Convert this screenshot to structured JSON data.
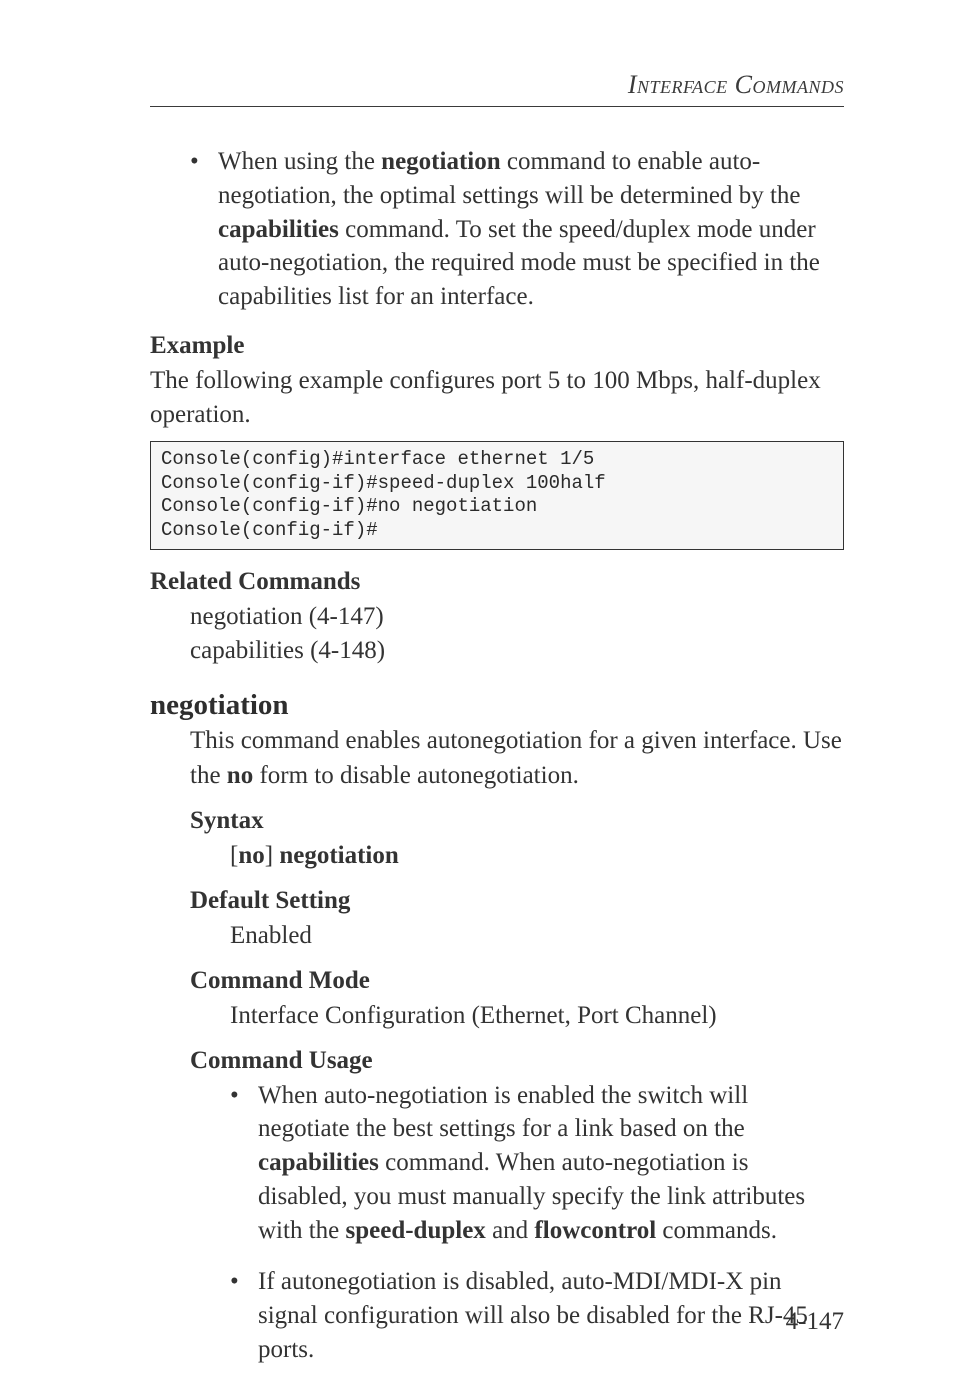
{
  "header": {
    "running_head": "Interface Commands"
  },
  "top_bullet": {
    "text_before_neg": "When using the ",
    "neg": "negotiation",
    "after_neg": " command to enable auto-negotiation, the optimal settings will be determined by the ",
    "cap": "capabilities",
    "after_cap": " command. To set the speed/duplex mode under auto-negotiation, the required mode must be specified in the capabilities list for an interface."
  },
  "example": {
    "heading": "Example",
    "text": "The following example configures port 5 to 100 Mbps, half-duplex operation.",
    "code": "Console(config)#interface ethernet 1/5\nConsole(config-if)#speed-duplex 100half\nConsole(config-if)#no negotiation\nConsole(config-if)#"
  },
  "related": {
    "heading": "Related Commands",
    "line1": "negotiation (4-147)",
    "line2": "capabilities (4-148)"
  },
  "cmd": {
    "name": "negotiation",
    "desc_before_no": "This command enables autonegotiation for a given interface. Use the ",
    "no": "no",
    "desc_after_no": " form to disable autonegotiation."
  },
  "syntax": {
    "heading": "Syntax",
    "open": "[",
    "no": "no",
    "close": "] ",
    "cmd": "negotiation"
  },
  "default_setting": {
    "heading": "Default Setting",
    "value": "Enabled"
  },
  "command_mode": {
    "heading": "Command Mode",
    "value": "Interface Configuration (Ethernet, Port Channel)"
  },
  "usage": {
    "heading": "Command Usage",
    "b1_pre": "When auto-negotiation is enabled the switch will negotiate the best settings for a link based on the ",
    "b1_cap": "capabilities",
    "b1_mid": " command. When auto-negotiation is disabled, you must manually specify the link attributes with the ",
    "b1_sd": "speed-duplex",
    "b1_and": " and ",
    "b1_fc": "flowcontrol",
    "b1_end": " commands.",
    "b2": "If autonegotiation is disabled, auto-MDI/MDI-X pin signal configuration will also be disabled for the RJ-45 ports."
  },
  "footer": {
    "page": "4-147"
  }
}
